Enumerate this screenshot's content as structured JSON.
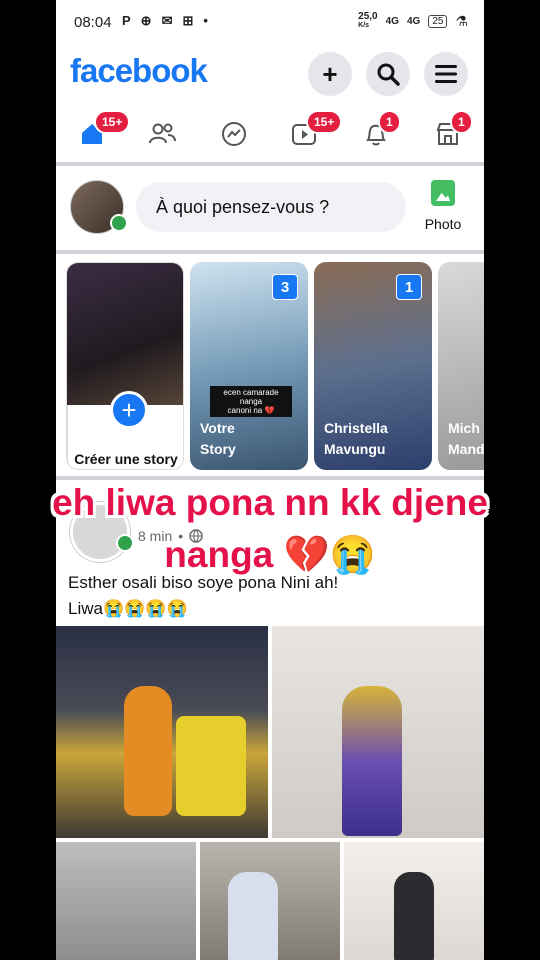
{
  "status": {
    "time": "08:04",
    "left_icons": [
      "P",
      "⊕",
      "✉",
      "⊞",
      "•"
    ],
    "speed": "25,0",
    "speed_unit": "K/s",
    "signal1": "4G",
    "signal2": "4G",
    "battery": "25"
  },
  "header": {
    "logo": "facebook",
    "add_icon": "+",
    "search_icon": "⌕",
    "menu_icon": "☰"
  },
  "nav": {
    "home_badge": "15+",
    "video_badge": "15+",
    "notif_badge": "1",
    "market_badge": "1"
  },
  "composer": {
    "placeholder": "À quoi pensez-vous ?",
    "photo_label": "Photo"
  },
  "stories": {
    "create_label": "Créer une story",
    "items": [
      {
        "name": "Votre\nStory",
        "count": "3"
      },
      {
        "name": "Christella\nMavungu",
        "count": "1"
      },
      {
        "name": "Mich\nMand",
        "count": ""
      }
    ],
    "story1_caption": "ecen camarade nanga\ncanoni na 💔"
  },
  "overlay": {
    "line1": "eh liwa pona nn kk djene",
    "line2": "nanga 💔😭"
  },
  "post": {
    "time": "8 min",
    "dot": "•",
    "text": "Esther osali biso soye pona Nini ah!\nLiwa😭😭😭😭"
  }
}
